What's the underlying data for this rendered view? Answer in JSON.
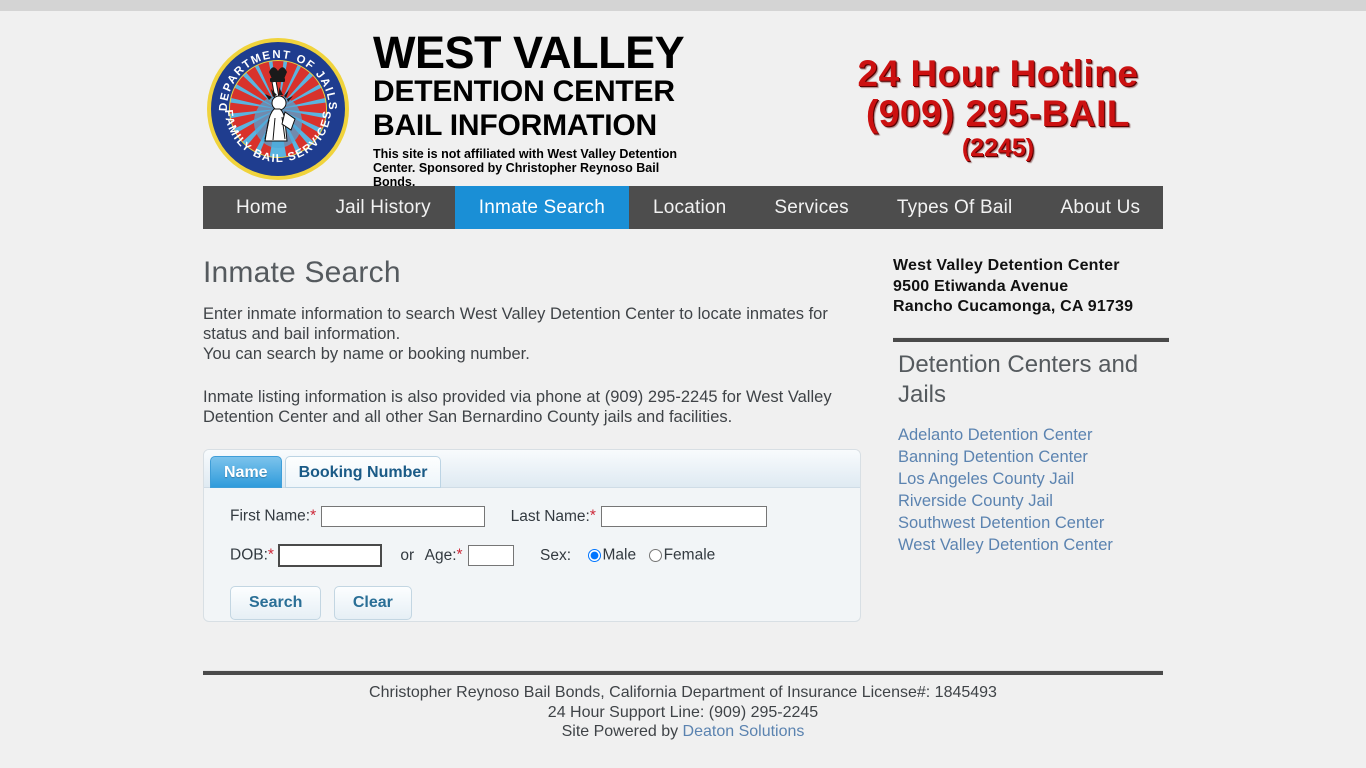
{
  "header": {
    "logo_icon": "department-of-jails-seal",
    "logo_ring_top_text": "DEPARTMENT OF JAILS",
    "logo_ring_bottom_text": "FAMILY BAIL SERVICES",
    "title_line1": "WEST VALLEY",
    "title_line2": "DETENTION CENTER",
    "title_line3": "BAIL INFORMATION",
    "disclaimer": "This site is not affiliated with West Valley Detention Center. Sponsored by Christopher Reynoso Bail Bonds.",
    "hotline_line1": "24 Hour Hotline",
    "hotline_line2": "(909) 295-BAIL",
    "hotline_line3": "(2245)",
    "hotline_color": "#cc1111"
  },
  "nav": {
    "active_color": "#1a8fd6",
    "bar_color": "#4d4d4d",
    "items": [
      {
        "label": "Home",
        "active": false
      },
      {
        "label": "Jail History",
        "active": false
      },
      {
        "label": "Inmate Search",
        "active": true
      },
      {
        "label": "Location",
        "active": false
      },
      {
        "label": "Services",
        "active": false
      },
      {
        "label": "Types Of Bail",
        "active": false
      },
      {
        "label": "About Us",
        "active": false
      }
    ]
  },
  "main": {
    "page_title": "Inmate Search",
    "intro_paragraph": "Enter inmate information to search West Valley Detention Center to locate inmates for status and bail information.",
    "intro_paragraph2": "You can search by name or booking number.",
    "phone_paragraph": "Inmate listing information is also provided via phone at (909) 295-2245 for West Valley Detention Center and all other San Bernardino County jails and facilities.",
    "tabs": [
      {
        "label": "Name",
        "active": true
      },
      {
        "label": "Booking Number",
        "active": false
      }
    ],
    "form": {
      "first_name_label": "First Name:",
      "first_name_value": "",
      "first_name_required": "*",
      "last_name_label": "Last Name:",
      "last_name_value": "",
      "last_name_required": "*",
      "dob_label": "DOB:",
      "dob_value": "",
      "dob_required": "*",
      "or_label": "or",
      "age_label": "Age:",
      "age_value": "",
      "age_required": "*",
      "sex_label": "Sex:",
      "sex_male_label": "Male",
      "sex_female_label": "Female",
      "sex_selected": "Male",
      "search_button": "Search",
      "clear_button": "Clear"
    }
  },
  "sidebar": {
    "facility_name": "West Valley Detention Center",
    "facility_street": "9500 Etiwanda Avenue",
    "facility_city": "Rancho Cucamonga, CA 91739",
    "heading": "Detention Centers and Jails",
    "links": [
      "Adelanto Detention Center",
      "Banning Detention Center",
      "Los Angeles County Jail",
      "Riverside County Jail",
      "Southwest Detention Center",
      "West Valley Detention Center"
    ],
    "link_color": "#5b83b0"
  },
  "footer": {
    "line1": "Christopher Reynoso Bail Bonds, California Department of Insurance License#: 1845493",
    "line2": "24 Hour Support Line: (909) 295-2245",
    "line3_prefix": "Site Powered by ",
    "line3_link": "Deaton Solutions"
  }
}
